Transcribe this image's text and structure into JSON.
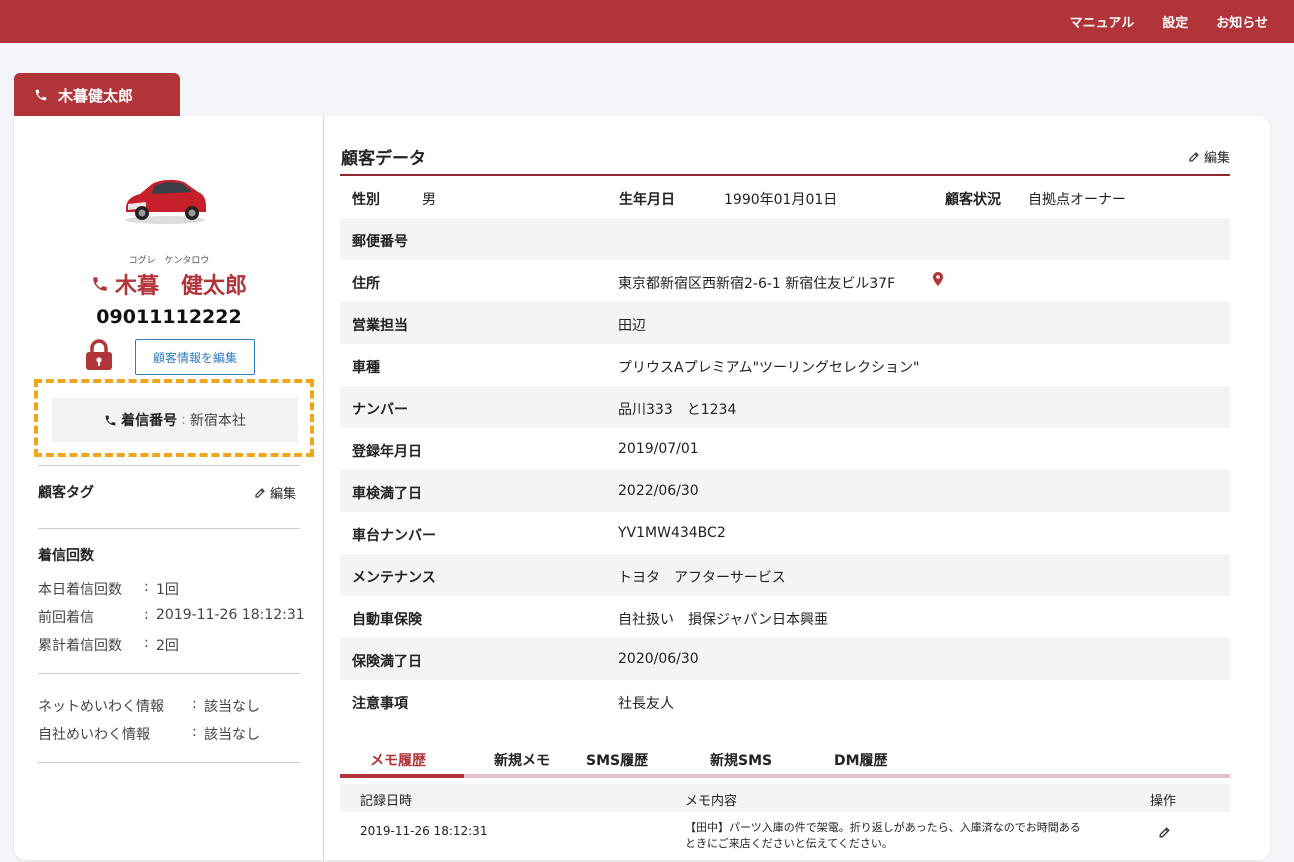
{
  "topnav": {
    "manual": "マニュアル",
    "settings": "設定",
    "notices": "お知らせ"
  },
  "tab_name": "木暮健太郎",
  "customer": {
    "ruby": "コグレ　ケンタロウ",
    "name": "木暮　健太郎",
    "phone": "09011112222",
    "edit_button": "顧客情報を編集",
    "incoming_label": "着信番号",
    "incoming_sep": ":",
    "incoming_value": "新宿本社"
  },
  "sidebar": {
    "tags_title": "顧客タグ",
    "edit": "編集",
    "calls_title": "着信回数",
    "stats": [
      {
        "k": "本日着信回数",
        "c": ":",
        "v": "1回"
      },
      {
        "k": "前回着信",
        "c": ":",
        "v": "2019-11-26 18:12:31"
      },
      {
        "k": "累計着信回数",
        "c": ":",
        "v": "2回"
      }
    ],
    "meiwaku": [
      {
        "k": "ネットめいわく情報",
        "c": ":",
        "v": "該当なし"
      },
      {
        "k": "自社めいわく情報",
        "c": ":",
        "v": "該当なし"
      }
    ]
  },
  "main": {
    "title": "顧客データ",
    "edit": "編集",
    "row0": {
      "gender_k": "性別",
      "gender_v": "男",
      "birth_k": "生年月日",
      "birth_v": "1990年01月01日",
      "status_k": "顧客状況",
      "status_v": "自拠点オーナー"
    },
    "rows": [
      {
        "k": "郵便番号",
        "v": ""
      },
      {
        "k": "住所",
        "v": "東京都新宿区西新宿2-6-1 新宿住友ビル37F"
      },
      {
        "k": "営業担当",
        "v": "田辺"
      },
      {
        "k": "車種",
        "v": "プリウスAプレミアム\"ツーリングセレクション\""
      },
      {
        "k": "ナンバー",
        "v": "品川333　と1234"
      },
      {
        "k": "登録年月日",
        "v": "2019/07/01"
      },
      {
        "k": "車検満了日",
        "v": "2022/06/30"
      },
      {
        "k": "車台ナンバー",
        "v": "YV1MW434BC2"
      },
      {
        "k": "メンテナンス",
        "v": "トヨタ　アフターサービス"
      },
      {
        "k": "自動車保険",
        "v": "自社扱い　損保ジャパン日本興亜"
      },
      {
        "k": "保険満了日",
        "v": "2020/06/30"
      },
      {
        "k": "注意事項",
        "v": "社長友人"
      }
    ],
    "tabs": [
      "メモ履歴",
      "新規メモ",
      "SMS履歴",
      "新規SMS",
      "DM履歴"
    ],
    "table": {
      "headers": [
        "記録日時",
        "メモ内容",
        "操作"
      ],
      "row": {
        "date": "2019-11-26 18:12:31",
        "memo_line1": "【田中】パーツ入庫の件で架電。折り返しがあったら、入庫済なのでお時間ある",
        "memo_line2": "ときにご来店くださいと伝えてください。"
      }
    }
  },
  "colors": {
    "brand": "#b03438",
    "highlight": "#f0a51a",
    "link": "#2f7bc0"
  }
}
